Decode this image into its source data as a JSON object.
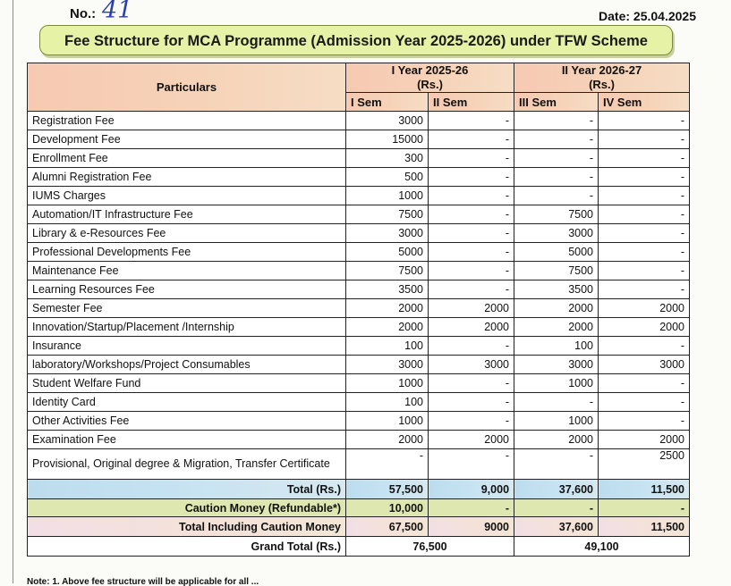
{
  "header": {
    "no_label": "No.:",
    "no_value": "41",
    "date": "Date: 25.04.2025"
  },
  "title": "Fee Structure for MCA Programme (Admission Year 2025-2026) under TFW Scheme",
  "table": {
    "particulars_header": "Particulars",
    "year1_header": "I Year 2025-26",
    "year1_unit": "(Rs.)",
    "year2_header": "II Year 2026-27",
    "year2_unit": "(Rs.)",
    "sem_headers": [
      "I Sem",
      "II Sem",
      "III Sem",
      "IV Sem"
    ],
    "rows": [
      {
        "label": "Registration Fee",
        "values": [
          "3000",
          "-",
          "-",
          "-"
        ]
      },
      {
        "label": "Development Fee",
        "values": [
          "15000",
          "-",
          "-",
          "-"
        ]
      },
      {
        "label": "Enrollment Fee",
        "values": [
          "300",
          "-",
          "-",
          "-"
        ]
      },
      {
        "label": "Alumni Registration Fee",
        "values": [
          "500",
          "-",
          "-",
          "-"
        ]
      },
      {
        "label": "IUMS Charges",
        "values": [
          "1000",
          "-",
          "-",
          "-"
        ]
      },
      {
        "label": "Automation/IT Infrastructure Fee",
        "values": [
          "7500",
          "-",
          "7500",
          "-"
        ]
      },
      {
        "label": "Library & e-Resources Fee",
        "values": [
          "3000",
          "-",
          "3000",
          "-"
        ]
      },
      {
        "label": "Professional Developments Fee",
        "values": [
          "5000",
          "-",
          "5000",
          "-"
        ]
      },
      {
        "label": "Maintenance Fee",
        "values": [
          "7500",
          "-",
          "7500",
          "-"
        ]
      },
      {
        "label": "Learning Resources Fee",
        "values": [
          "3500",
          "-",
          "3500",
          "-"
        ]
      },
      {
        "label": "Semester Fee",
        "values": [
          "2000",
          "2000",
          "2000",
          "2000"
        ]
      },
      {
        "label": "Innovation/Startup/Placement /Internship",
        "values": [
          "2000",
          "2000",
          "2000",
          "2000"
        ]
      },
      {
        "label": "Insurance",
        "values": [
          "100",
          "-",
          "100",
          "-"
        ]
      },
      {
        "label": "laboratory/Workshops/Project Consumables",
        "values": [
          "3000",
          "3000",
          "3000",
          "3000"
        ]
      },
      {
        "label": "Student Welfare Fund",
        "values": [
          "1000",
          "-",
          "1000",
          "-"
        ]
      },
      {
        "label": "Identity Card",
        "values": [
          "100",
          "-",
          "-",
          "-"
        ]
      },
      {
        "label": "Other Activities Fee",
        "values": [
          "1000",
          "-",
          "1000",
          "-"
        ]
      },
      {
        "label": "Examination Fee",
        "values": [
          "2000",
          "2000",
          "2000",
          "2000"
        ]
      },
      {
        "label": "Provisional, Original degree & Migration, Transfer Certificate",
        "values": [
          "-",
          "-",
          "-",
          "2500"
        ]
      }
    ],
    "total": {
      "label": "Total (Rs.)",
      "values": [
        "57,500",
        "9,000",
        "37,600",
        "11,500"
      ]
    },
    "caution": {
      "label": "Caution Money (Refundable*)",
      "values": [
        "10,000",
        "-",
        "-",
        "-"
      ]
    },
    "total_incl": {
      "label": "Total Including Caution Money",
      "values": [
        "67,500",
        "9000",
        "37,600",
        "11,500"
      ]
    },
    "grand_total": {
      "label": "Grand Total (Rs.)",
      "year1": "76,500",
      "year2": "49,100"
    }
  },
  "footer_note": "Note: 1. Above fee structure will be applicable for all ..."
}
